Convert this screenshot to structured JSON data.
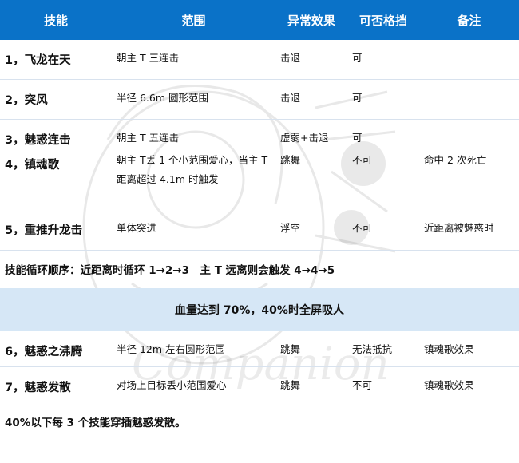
{
  "headers": [
    "技能",
    "范围",
    "异常效果",
    "可否格挡",
    "备注"
  ],
  "rows_top": [
    {
      "name": "1，飞龙在天",
      "range": "朝主 T 三连击",
      "effect": "击退",
      "block": "可",
      "note": ""
    },
    {
      "name": "2，突风",
      "range": "半径 6.6m 圆形范围",
      "effect": "击退",
      "block": "可",
      "note": ""
    },
    {
      "name": "3，魅惑连击",
      "range": "朝主 T 五连击",
      "effect": "虚弱+击退",
      "block": "可",
      "note": ""
    },
    {
      "name": "4，镇魂歌",
      "range": "朝主 T丢 1 个小范围爱心，当主 T 距离超过 4.1m 时触发",
      "effect": "跳舞",
      "block": "不可",
      "note": "命中 2 次死亡"
    },
    {
      "name": "5，重推升龙击",
      "range": "单体突进",
      "effect": "浮空",
      "block": "不可",
      "note": "近距离被魅惑时"
    }
  ],
  "cycle_note": "技能循环顺序：近距离时循环 1→2→3　主 T 远离则会触发 4→4→5",
  "phase_band": "血量达到 70%，40%时全屏吸人",
  "rows_bottom": [
    {
      "name": "6，魅惑之沸腾",
      "range": "半径 12m 左右圆形范围",
      "effect": "跳舞",
      "block": "无法抵抗",
      "note": "镇魂歌效果"
    },
    {
      "name": "7，魅惑发散",
      "range": "对场上目标丢小范围爱心",
      "effect": "跳舞",
      "block": "不可",
      "note": "镇魂歌效果"
    }
  ],
  "final_note": "40%以下每 3 个技能穿插魅惑发散。",
  "watermark_text": "Companion",
  "colors": {
    "header_bg": "#0a72c8",
    "band_bg": "#d6e7f6",
    "header_text": "#ffffff"
  }
}
